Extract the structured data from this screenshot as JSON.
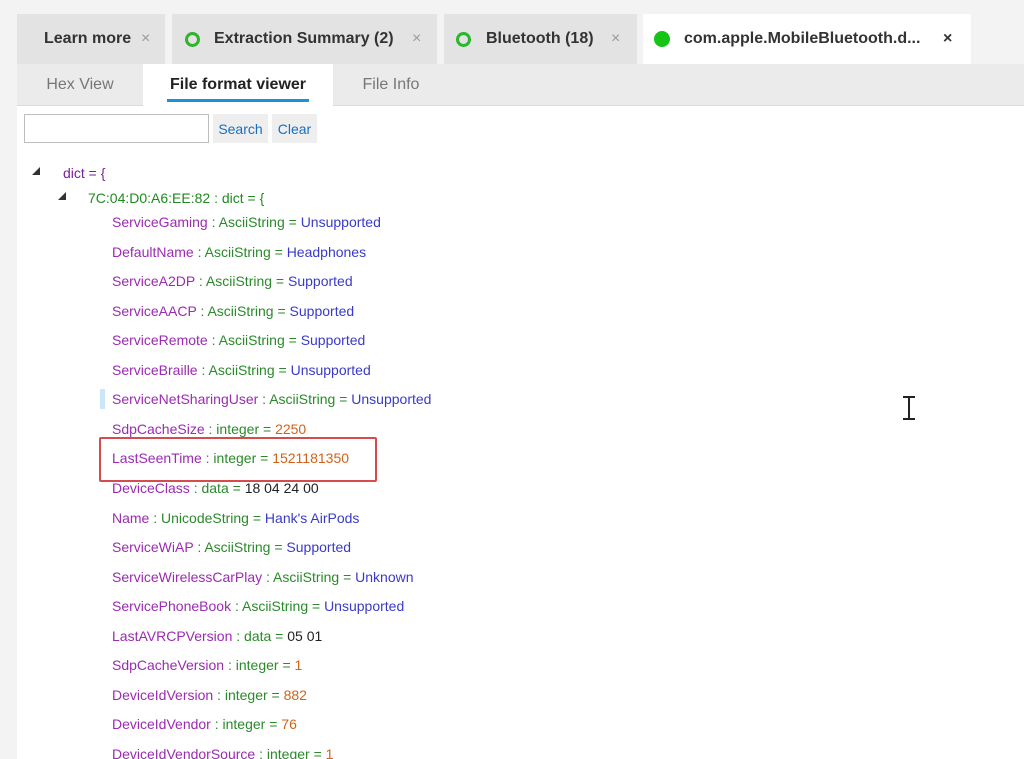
{
  "doc_tabs": [
    {
      "label": "Learn more",
      "close": "×"
    },
    {
      "label": "Extraction Summary (2)",
      "close": "×",
      "icon": "green-ring-icon"
    },
    {
      "label": "Bluetooth (18)",
      "close": "×",
      "icon": "green-ring-icon"
    },
    {
      "label": "com.apple.MobileBluetooth.d...",
      "close": "×",
      "icon": "green-dot-icon"
    }
  ],
  "sub_tabs": [
    "Hex View",
    "File format viewer",
    "File Info"
  ],
  "search": {
    "value": "",
    "placeholder": "",
    "search_label": "Search",
    "clear_label": "Clear"
  },
  "tree": {
    "root": "dict = {",
    "node": "7C:04:D0:A6:EE:82 : dict = {",
    "entries": [
      {
        "key": "ServiceGaming",
        "sep": " : AsciiString = ",
        "value": "Unsupported"
      },
      {
        "key": "DefaultName",
        "sep": " : AsciiString = ",
        "value": "Headphones"
      },
      {
        "key": "ServiceA2DP",
        "sep": " : AsciiString = ",
        "value": "Supported"
      },
      {
        "key": "ServiceAACP",
        "sep": " : AsciiString = ",
        "value": "Supported"
      },
      {
        "key": "ServiceRemote",
        "sep": " : AsciiString = ",
        "value": "Supported"
      },
      {
        "key": "ServiceBraille",
        "sep": " : AsciiString = ",
        "value": "Unsupported"
      },
      {
        "key": "ServiceNetSharingUser",
        "sep": " : AsciiString = ",
        "value": "Unsupported"
      },
      {
        "key": "SdpCacheSize",
        "sep": " : integer = ",
        "value": "2250"
      },
      {
        "key": "LastSeenTime",
        "sep": " : integer = ",
        "value": "1521181350"
      },
      {
        "key": "DeviceClass",
        "sep": " : data = ",
        "value": "18 04 24 00"
      },
      {
        "key": "Name",
        "sep": " : UnicodeString = ",
        "value": "Hank's AirPods"
      },
      {
        "key": "ServiceWiAP",
        "sep": " : AsciiString = ",
        "value": "Supported"
      },
      {
        "key": "ServiceWirelessCarPlay",
        "sep": " : AsciiString = ",
        "value": "Unknown"
      },
      {
        "key": "ServicePhoneBook",
        "sep": " : AsciiString = ",
        "value": "Unsupported"
      },
      {
        "key": "LastAVRCPVersion",
        "sep": " : data = ",
        "value": "05 01"
      },
      {
        "key": "SdpCacheVersion",
        "sep": " : integer = ",
        "value": "1"
      },
      {
        "key": "DeviceIdVersion",
        "sep": " : integer = ",
        "value": "882"
      },
      {
        "key": "DeviceIdVendor",
        "sep": " : integer = ",
        "value": "76"
      },
      {
        "key": "DeviceIdVendorSource",
        "sep": " : integer = ",
        "value": "1"
      }
    ]
  },
  "colors": {
    "accent": "#1993d6",
    "highlight_border": "#d64b4b",
    "status_green": "#16c416"
  }
}
